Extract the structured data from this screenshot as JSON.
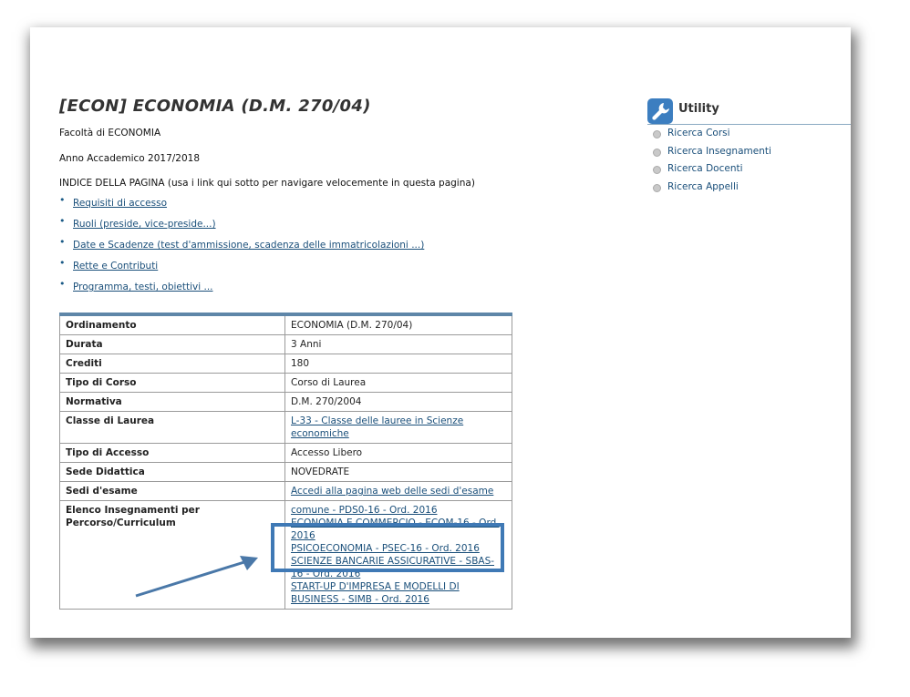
{
  "title": "[ECON]  ECONOMIA (D.M. 270/04)",
  "faculty": "Facoltà di ECONOMIA",
  "academic_year": "Anno Accademico 2017/2018",
  "index_heading": "INDICE DELLA PAGINA (usa i link qui sotto per navigare velocemente in questa pagina)",
  "index_links": [
    "Requisiti di accesso",
    "Ruoli (preside, vice-preside...)",
    "Date e Scadenze (test d'ammissione, scadenza delle immatricolazioni ...)",
    "Rette e Contributi",
    "Programma, testi, obiettivi ..."
  ],
  "table": {
    "ordinamento_label": "Ordinamento",
    "ordinamento_value": "ECONOMIA (D.M. 270/04)",
    "durata_label": "Durata",
    "durata_value": "3 Anni",
    "crediti_label": "Crediti",
    "crediti_value": "180",
    "tipo_corso_label": "Tipo di Corso",
    "tipo_corso_value": "Corso di Laurea",
    "normativa_label": "Normativa",
    "normativa_value": "D.M. 270/2004",
    "classe_label": "Classe di Laurea",
    "classe_value": "L-33 - Classe delle lauree in Scienze economiche",
    "accesso_label": "Tipo di Accesso",
    "accesso_value": "Accesso Libero",
    "sede_label": "Sede Didattica",
    "sede_value": "NOVEDRATE",
    "sedi_esame_label": "Sedi d'esame",
    "sedi_esame_value": "Accedi alla pagina web delle sedi d'esame",
    "elenco_label": "Elenco Insegnamenti per Percorso/Curriculum",
    "curricula": [
      "comune - PDS0-16 - Ord. 2016",
      "ECONOMIA E COMMERCIO - ECOM-16 - Ord. 2016",
      "PSICOECONOMIA - PSEC-16 - Ord. 2016",
      "SCIENZE BANCARIE ASSICURATIVE - SBAS-16 - Ord. 2016",
      "START-UP D'IMPRESA E MODELLI DI BUSINESS - SIMB - Ord. 2016"
    ]
  },
  "utility": {
    "title": "Utility",
    "items": [
      "Ricerca Corsi",
      "Ricerca Insegnamenti",
      "Ricerca Docenti",
      "Ricerca Appelli"
    ]
  },
  "colors": {
    "link": "#1a4f7a",
    "table_top_border": "#5e86a8",
    "highlight": "#3f79b5",
    "arrow": "#4a78a8"
  },
  "icons": {
    "utility": "wrench-icon",
    "bullet": "bullet-icon",
    "util_bullet": "grey-dot-icon"
  }
}
